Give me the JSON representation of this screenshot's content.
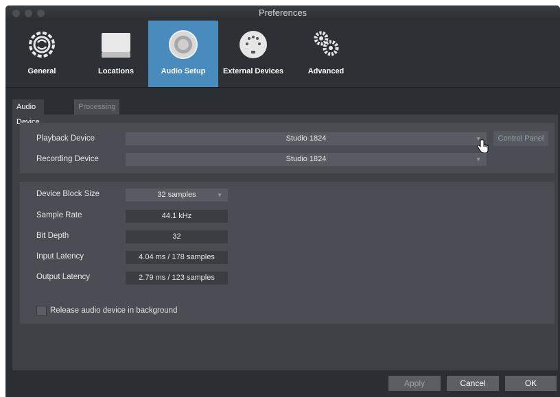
{
  "window": {
    "title": "Preferences"
  },
  "toolbar": {
    "items": [
      {
        "label": "General",
        "icon": "gear-cycle-icon"
      },
      {
        "label": "Locations",
        "icon": "drive-icon"
      },
      {
        "label": "Audio Setup",
        "icon": "speaker-icon"
      },
      {
        "label": "External Devices",
        "icon": "midi-icon"
      },
      {
        "label": "Advanced",
        "icon": "gears-icon"
      }
    ],
    "active": "Audio Setup"
  },
  "tabs": [
    {
      "label": "Audio Device"
    },
    {
      "label": "Processing"
    }
  ],
  "device": {
    "playback_label": "Playback Device",
    "playback_value": "Studio 1824",
    "recording_label": "Recording Device",
    "recording_value": "Studio 1824",
    "control_panel_label": "Control Panel"
  },
  "settings": {
    "block_size_label": "Device Block Size",
    "block_size_value": "32 samples",
    "sample_rate_label": "Sample Rate",
    "sample_rate_value": "44.1 kHz",
    "bit_depth_label": "Bit Depth",
    "bit_depth_value": "32",
    "input_latency_label": "Input Latency",
    "input_latency_value": "4.04 ms / 178 samples",
    "output_latency_label": "Output Latency",
    "output_latency_value": "2.79 ms / 123 samples",
    "release_label": "Release audio device in background"
  },
  "footer": {
    "apply_label": "Apply",
    "cancel_label": "Cancel",
    "ok_label": "OK"
  },
  "colors": {
    "accent": "#4a8bbd",
    "window_bg": "#2b2e33",
    "panel_bg": "#4a4e54"
  }
}
